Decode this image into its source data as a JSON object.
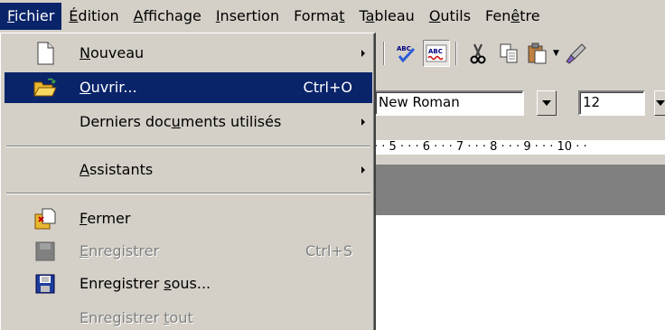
{
  "menubar": {
    "items": [
      {
        "pre": "",
        "u": "F",
        "post": "ichier"
      },
      {
        "pre": "",
        "u": "É",
        "post": "dition"
      },
      {
        "pre": "",
        "u": "A",
        "post": "ffichage"
      },
      {
        "pre": "",
        "u": "I",
        "post": "nsertion"
      },
      {
        "pre": "Forma",
        "u": "t",
        "post": ""
      },
      {
        "pre": "T",
        "u": "a",
        "post": "bleau"
      },
      {
        "pre": "",
        "u": "O",
        "post": "utils"
      },
      {
        "pre": "Fen",
        "u": "ê",
        "post": "tre"
      }
    ]
  },
  "file_menu": {
    "nouveau": {
      "pre": "",
      "u": "N",
      "post": "ouveau",
      "icon": "new-document-icon"
    },
    "ouvrir": {
      "pre": "",
      "u": "O",
      "post": "uvrir...",
      "shortcut": "Ctrl+O",
      "icon": "open-folder-icon"
    },
    "derniers": {
      "pre": "Derniers doc",
      "u": "u",
      "post": "ments utilisés"
    },
    "assistants": {
      "pre": "",
      "u": "A",
      "post": "ssistants"
    },
    "fermer": {
      "pre": "",
      "u": "F",
      "post": "ermer",
      "icon": "close-document-icon"
    },
    "enregistrer": {
      "pre": "",
      "u": "E",
      "post": "nregistrer",
      "shortcut": "Ctrl+S",
      "icon": "save-icon"
    },
    "enregistrer_sous": {
      "pre": "Enregistrer ",
      "u": "s",
      "post": "ous...",
      "icon": "save-as-icon"
    },
    "enregistrer_tout": {
      "pre": "Enregistrer ",
      "u": "t",
      "post": "out"
    }
  },
  "formatbar": {
    "font_name": "New Roman",
    "font_size": "12"
  },
  "ruler": {
    "text": "· · 5 · · · 6 · · · 7 · · · 8 · · · 9 · · · 10 · ·"
  },
  "colors": {
    "highlight": "#0a246a",
    "face": "#d4d0c8",
    "shadow": "#808080"
  }
}
